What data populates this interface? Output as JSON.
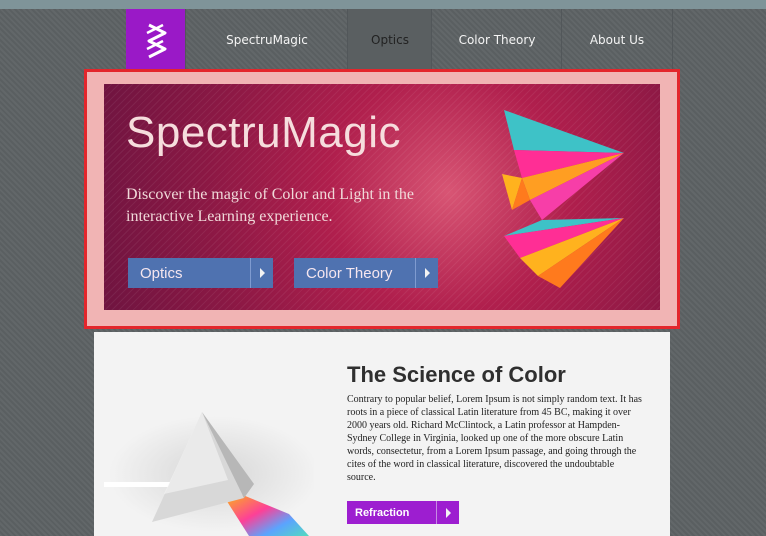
{
  "nav": {
    "items": [
      {
        "label": "SpectruMagic"
      },
      {
        "label": "Optics",
        "active": true
      },
      {
        "label": "Color Theory"
      },
      {
        "label": "About Us"
      }
    ]
  },
  "hero": {
    "title": "SpectruMagic",
    "description": "Discover the magic of Color and Light in the interactive Learning experience.",
    "buttons": [
      {
        "label": "Optics"
      },
      {
        "label": "Color Theory"
      }
    ]
  },
  "content": {
    "title": "The Science of Color",
    "text": "Contrary to popular belief, Lorem Ipsum is not simply random text. It has roots in a piece of classical Latin literature from 45 BC, making it over 2000 years old. Richard McClintock, a Latin professor at Hampden-Sydney College in Virginia, looked up one of the more obscure Latin words, consectetur, from a Lorem Ipsum passage, and going through the cites of the word in classical literature, discovered the undoubtable source.",
    "button": "Refraction"
  },
  "colors": {
    "brand_purple": "#9a19c7",
    "hero_button": "#4f72b0",
    "highlight_outline": "#e3262c"
  }
}
